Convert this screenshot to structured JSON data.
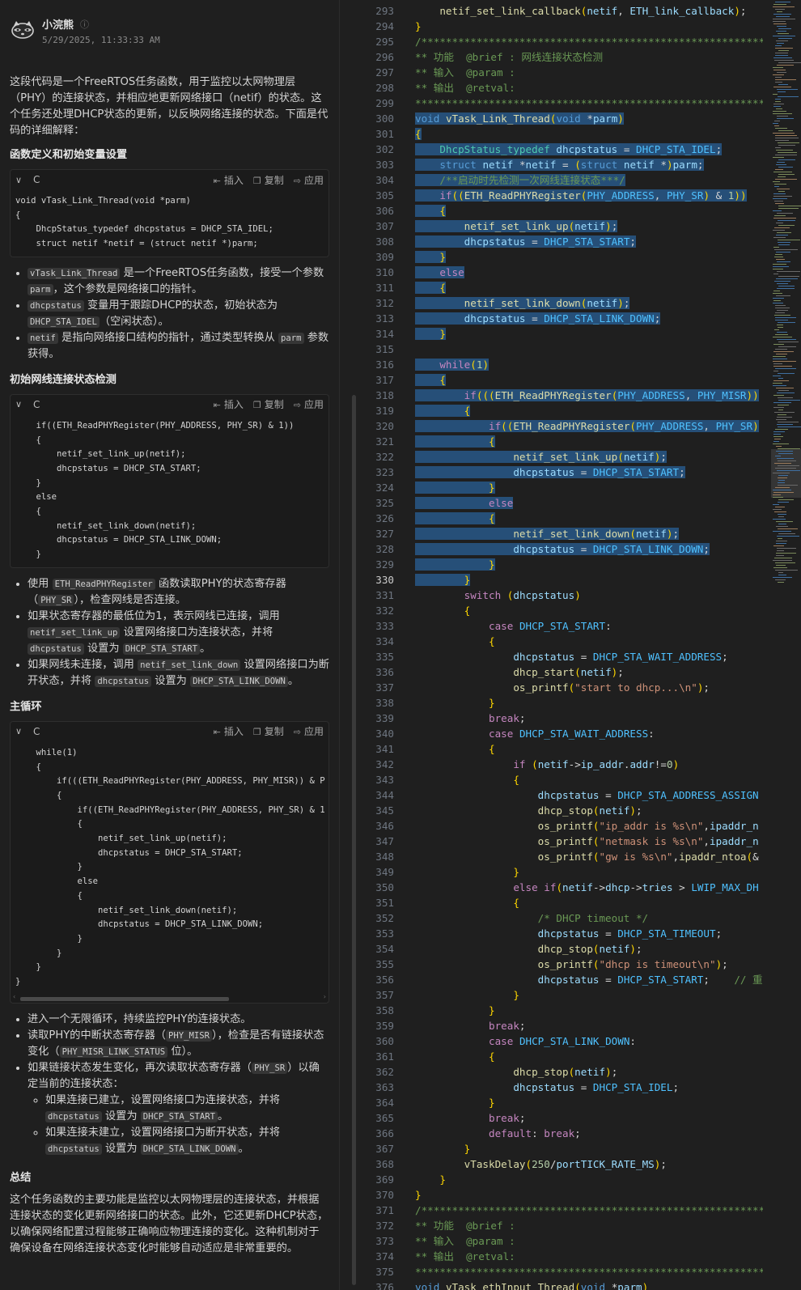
{
  "chat": {
    "author": "小浣熊",
    "timestamp": "5/29/2025, 11:33:33 AM",
    "intro": "这段代码是一个FreeRTOS任务函数，用于监控以太网物理层（PHY）的连接状态，并相应地更新网络接口（netif）的状态。这个任务还处理DHCP状态的更新，以反映网络连接的状态。下面是代码的详细解释：",
    "code_actions": {
      "insert": "插入",
      "copy": "复制",
      "apply": "应用"
    },
    "code_lang": "C",
    "sec1": {
      "title": "函数定义和初始变量设置",
      "code": "void vTask_Link_Thread(void *parm)\n{\n    DhcpStatus_typedef dhcpstatus = DHCP_STA_IDEL;\n    struct netif *netif = (struct netif *)parm;",
      "bullets": [
        [
          "",
          "vTask_Link_Thread",
          " 是一个FreeRTOS任务函数，接受一个参数 ",
          "parm",
          "，这个参数是网络接口的指针。"
        ],
        [
          "",
          "dhcpstatus",
          " 变量用于跟踪DHCP的状态，初始状态为 ",
          "DHCP_STA_IDEL",
          "（空闲状态）。"
        ],
        [
          "",
          "netif",
          " 是指向网络接口结构的指针，通过类型转换从 ",
          "parm",
          " 参数获得。"
        ]
      ]
    },
    "sec2": {
      "title": "初始网线连接状态检测",
      "code": "    if((ETH_ReadPHYRegister(PHY_ADDRESS, PHY_SR) & 1))\n    {\n        netif_set_link_up(netif);\n        dhcpstatus = DHCP_STA_START;\n    }\n    else\n    {\n        netif_set_link_down(netif);\n        dhcpstatus = DHCP_STA_LINK_DOWN;\n    }",
      "bullets": [
        [
          "使用 ",
          "ETH_ReadPHYRegister",
          " 函数读取PHY的状态寄存器（",
          "PHY_SR",
          "），检查网线是否连接。"
        ],
        [
          "如果状态寄存器的最低位为1，表示网线已连接，调用 ",
          "netif_set_link_up",
          " 设置网络接口为连接状态，并将 ",
          "dhcpstatus",
          " 设置为 ",
          "DHCP_STA_START",
          "。"
        ],
        [
          "如果网线未连接，调用 ",
          "netif_set_link_down",
          " 设置网络接口为断开状态，并将 ",
          "dhcpstatus",
          " 设置为 ",
          "DHCP_STA_LINK_DOWN",
          "。"
        ]
      ]
    },
    "sec3": {
      "title": "主循环",
      "code": "    while(1)\n    {\n        if(((ETH_ReadPHYRegister(PHY_ADDRESS, PHY_MISR)) & P\n        {\n            if((ETH_ReadPHYRegister(PHY_ADDRESS, PHY_SR) & 1\n            {\n                netif_set_link_up(netif);\n                dhcpstatus = DHCP_STA_START;\n            }\n            else\n            {\n                netif_set_link_down(netif);\n                dhcpstatus = DHCP_STA_LINK_DOWN;\n            }\n        }\n    }\n}",
      "bullets": [
        [
          "进入一个无限循环，持续监控PHY的连接状态。"
        ],
        [
          "读取PHY的中断状态寄存器（",
          "PHY_MISR",
          "），检查是否有链接状态变化（",
          "PHY_MISR_LINK_STATUS",
          " 位）。"
        ],
        [
          "如果链接状态发生变化，再次读取状态寄存器（",
          "PHY_SR",
          "）以确定当前的连接状态："
        ]
      ],
      "sub_bullets": [
        [
          "如果连接已建立，设置网络接口为连接状态，并将 ",
          "dhcpstatus",
          " 设置为 ",
          "DHCP_STA_START",
          "。"
        ],
        [
          "如果连接未建立，设置网络接口为断开状态，并将 ",
          "dhcpstatus",
          " 设置为 ",
          "DHCP_STA_LINK_DOWN",
          "。"
        ]
      ]
    },
    "summary": {
      "title": "总结",
      "text": "这个任务函数的主要功能是监控以太网物理层的连接状态，并根据连接状态的变化更新网络接口的状态。此外，它还更新DHCP状态，以确保网络配置过程能够正确响应物理连接的变化。这种机制对于确保设备在网络连接状态变化时能够自动适应是非常重要的。"
    }
  },
  "editor": {
    "active_line": 330,
    "first_line": 293,
    "lines": [
      "    netif_set_link_callback(netif, ETH_link_callback);",
      "}",
      "/*************************************************************",
      "** 功能  @brief : 网线连接状态检测",
      "** 输入  @param :",
      "** 输出  @retval:",
      "*************************************************************",
      "void vTask_Link_Thread(void *parm)",
      "{",
      "    DhcpStatus_typedef dhcpstatus = DHCP_STA_IDEL;",
      "    struct netif *netif = (struct netif *)parm;",
      "    /**启动时先检测一次网线连接状态***/",
      "    if((ETH_ReadPHYRegister(PHY_ADDRESS, PHY_SR) & 1))",
      "    {",
      "        netif_set_link_up(netif);",
      "        dhcpstatus = DHCP_STA_START;",
      "    }",
      "    else",
      "    {",
      "        netif_set_link_down(netif);",
      "        dhcpstatus = DHCP_STA_LINK_DOWN;",
      "    }",
      "",
      "    while(1)",
      "    {",
      "        if(((ETH_ReadPHYRegister(PHY_ADDRESS, PHY_MISR))",
      "        {",
      "            if((ETH_ReadPHYRegister(PHY_ADDRESS, PHY_SR)",
      "            {",
      "                netif_set_link_up(netif);",
      "                dhcpstatus = DHCP_STA_START;",
      "            }",
      "            else",
      "            {",
      "                netif_set_link_down(netif);",
      "                dhcpstatus = DHCP_STA_LINK_DOWN;",
      "            }",
      "        }",
      "        switch (dhcpstatus)",
      "        {",
      "            case DHCP_STA_START:",
      "            {",
      "                dhcpstatus = DHCP_STA_WAIT_ADDRESS;",
      "                dhcp_start(netif);",
      "                os_printf(\"start to dhcp...\\n\");",
      "            }",
      "            break;",
      "            case DHCP_STA_WAIT_ADDRESS:",
      "            {",
      "                if (netif->ip_addr.addr!=0)",
      "                {",
      "                    dhcpstatus = DHCP_STA_ADDRESS_ASSIGN",
      "                    dhcp_stop(netif);",
      "                    os_printf(\"ip_addr is %s\\n\",ipaddr_n",
      "                    os_printf(\"netmask is %s\\n\",ipaddr_n",
      "                    os_printf(\"gw is %s\\n\",ipaddr_ntoa(&",
      "                }",
      "                else if(netif->dhcp->tries > LWIP_MAX_DH",
      "                {",
      "                    /* DHCP timeout */",
      "                    dhcpstatus = DHCP_STA_TIMEOUT;",
      "                    dhcp_stop(netif);",
      "                    os_printf(\"dhcp is timeout\\n\");",
      "                    dhcpstatus = DHCP_STA_START;    // 重",
      "                }",
      "            }",
      "            break;",
      "            case DHCP_STA_LINK_DOWN:",
      "            {",
      "                dhcp_stop(netif);",
      "                dhcpstatus = DHCP_STA_IDEL;",
      "            }",
      "            break;",
      "            default: break;",
      "        }",
      "        vTaskDelay(250/portTICK_RATE_MS);",
      "    }",
      "}",
      "/*************************************************************",
      "** 功能  @brief :",
      "** 输入  @param :",
      "** 输出  @retval:",
      "*************************************************************",
      "void vTask_ethInput_Thread(void *parm)"
    ]
  }
}
